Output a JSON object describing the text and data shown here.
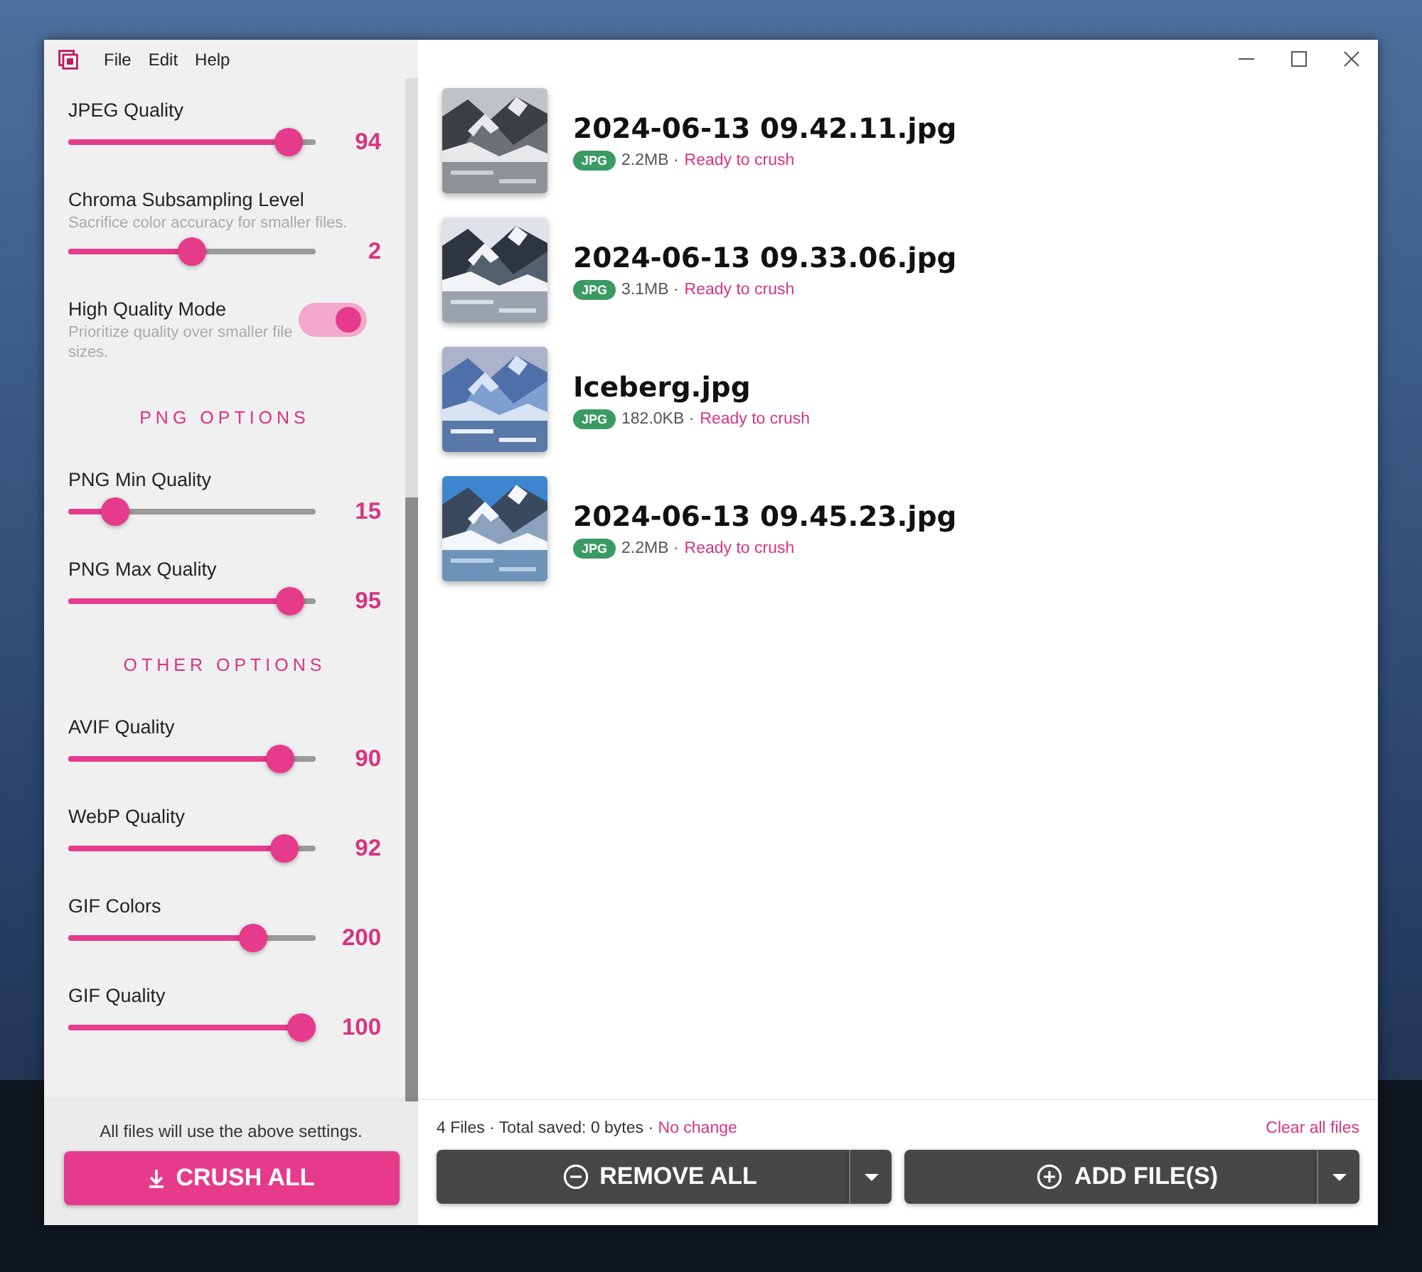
{
  "window": {
    "menu": [
      "File",
      "Edit",
      "Help"
    ]
  },
  "settings": [
    {
      "kind": "slider",
      "label": "JPEG Quality",
      "level": 0.94,
      "value": "94"
    },
    {
      "kind": "slider",
      "label": "Chroma Subsampling Level",
      "description": "Sacrifice color accuracy for smaller files.",
      "level": 0.5,
      "value": "2"
    },
    {
      "kind": "toggle",
      "label": "High Quality Mode",
      "description": "Prioritize quality over smaller file sizes.",
      "on": true
    },
    {
      "kind": "heading",
      "label": "PNG OPTIONS"
    },
    {
      "kind": "slider",
      "label": "PNG Min Quality",
      "level": 0.15,
      "value": "15"
    },
    {
      "kind": "slider",
      "label": "PNG Max Quality",
      "level": 0.95,
      "value": "95"
    },
    {
      "kind": "heading",
      "label": "OTHER OPTIONS"
    },
    {
      "kind": "slider",
      "label": "AVIF Quality",
      "level": 0.9,
      "value": "90"
    },
    {
      "kind": "slider",
      "label": "WebP Quality",
      "level": 0.92,
      "value": "92"
    },
    {
      "kind": "slider",
      "label": "GIF Colors",
      "level": 0.78,
      "value": "200"
    },
    {
      "kind": "slider",
      "label": "GIF Quality",
      "level": 1.0,
      "value": "100"
    }
  ],
  "sidebar_footer": {
    "note": "All files will use the above settings.",
    "button": "CRUSH ALL"
  },
  "files": [
    {
      "name": "2024-06-13 09.42.11.jpg",
      "badge": "JPG",
      "size": "2.2MB ·",
      "status": "Ready to crush"
    },
    {
      "name": "2024-06-13 09.33.06.jpg",
      "badge": "JPG",
      "size": "3.1MB ·",
      "status": "Ready to crush"
    },
    {
      "name": "Iceberg.jpg",
      "badge": "JPG",
      "size": "182.0KB ·",
      "status": "Ready to crush"
    },
    {
      "name": "2024-06-13 09.45.23.jpg",
      "badge": "JPG",
      "size": "2.2MB ·",
      "status": "Ready to crush"
    }
  ],
  "summary": {
    "totals": "4 Files · Total saved: 0 bytes ·",
    "change": "No change",
    "clear": "Clear all files"
  },
  "buttons": [
    {
      "kind": "remove",
      "label": "REMOVE ALL"
    },
    {
      "kind": "add",
      "label": "ADD FILE(S)"
    }
  ]
}
